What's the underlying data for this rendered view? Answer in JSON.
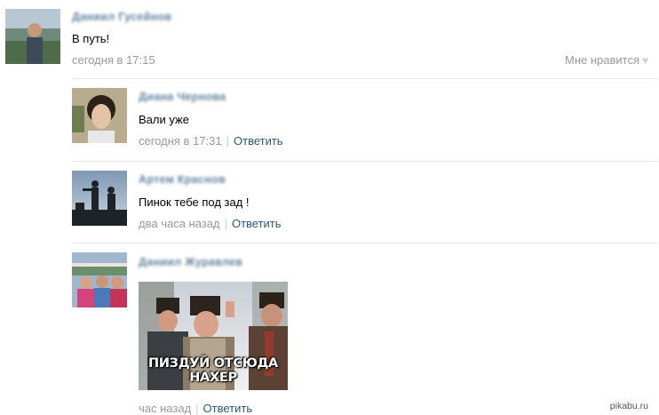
{
  "post": {
    "author": "Даниил Гусейнов",
    "text": "В путь!",
    "time": "сегодня в 17:15",
    "like_label": "Мне нравится",
    "like_icon": "heart-icon"
  },
  "comments": [
    {
      "author": "Диана Чернова",
      "text": "Вали уже",
      "time": "сегодня в 17:31",
      "reply_label": "Ответить"
    },
    {
      "author": "Артем Краснов",
      "text": "Пинок тебе под зад !",
      "time": "два часа назад",
      "reply_label": "Ответить"
    },
    {
      "author": "Даниил Журавлев",
      "text": "",
      "time": "час назад",
      "reply_label": "Ответить",
      "image_caption": "ПИЗДУЙ ОТСЮДА НАХЕР"
    }
  ],
  "watermark": "pikabu.ru"
}
